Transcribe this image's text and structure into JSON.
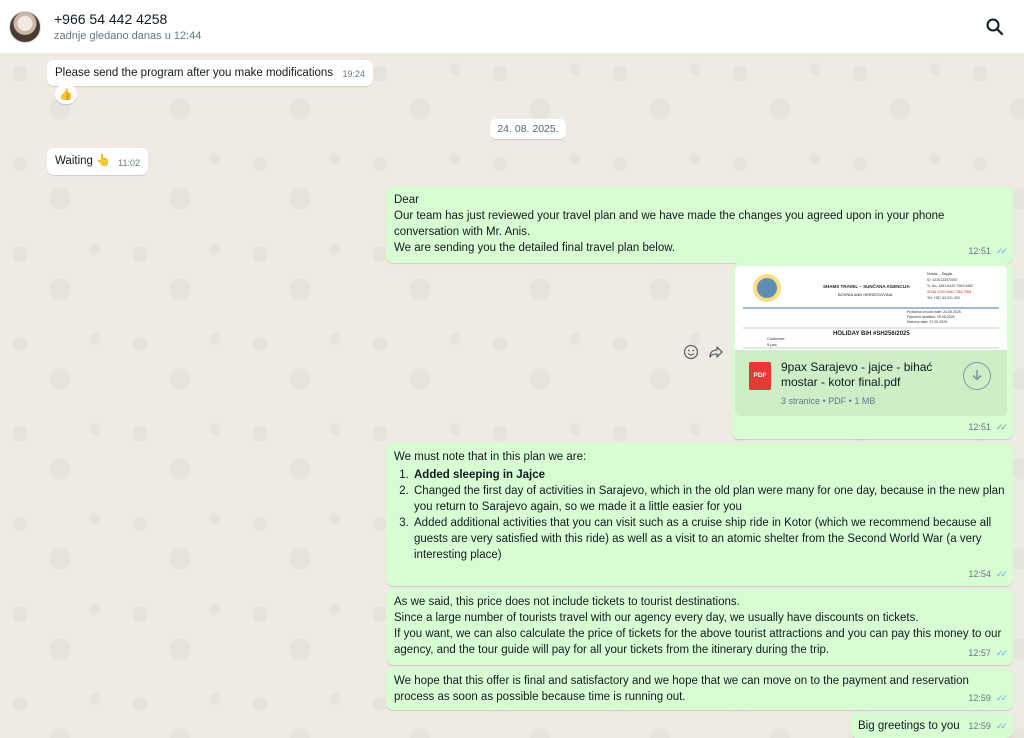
{
  "header": {
    "contact_name": "+966 54 442 4258",
    "last_seen": "zadnje gledano danas u 12:44"
  },
  "messages": {
    "m1": {
      "text": "Please send the program after you make modifications",
      "time": "19:24",
      "reaction": "👍"
    },
    "date_chip": "24. 08. 2025.",
    "m2": {
      "text": "Waiting 👆",
      "time": "11:02"
    },
    "m3": {
      "line1": "Dear",
      "line2": "Our team has just reviewed your travel plan and we have made the changes you agreed upon in your phone conversation with Mr. Anis.",
      "line3": "We are sending you the detailed final travel plan below.",
      "time": "12:51"
    },
    "m4": {
      "doc_preview": {
        "company": "SHAMS TRAVEL – SUNČANA AGENCIJA",
        "country": "BOSNIA AND HERZEGOVINA",
        "title": "HOLIDAY BiH #SH256/2025",
        "customer_label": "Customer:",
        "customer_value": "9 pax",
        "right_lines": [
          "Mostar – Šapjak",
          "ID: 4220133070007",
          "Tr. No. 1061-0022-7063-9482",
          "SH3A 2204 0940-7363-7964",
          "Tel: +387 63 021 000"
        ],
        "dates": [
          "Proforma Invoice date: 24.08.2025.",
          "Payment deadline: 25.08.2025.",
          "Delivery date: 07.09.2025."
        ]
      },
      "file_name": "9pax Sarajevo - jajce - bihać mostar - kotor final.pdf",
      "file_info": "3 stranice • PDF • 1 MB",
      "file_type": "PDF",
      "time": "12:51"
    },
    "m5": {
      "intro": "We must note that in this plan we are:",
      "items": [
        "Added sleeping in Jajce",
        "Changed the first day of activities in Sarajevo, which in the old plan were many for one day, because in the new plan you return to Sarajevo again, so we made it a little easier for you",
        "Added additional activities that you can visit such as a cruise ship ride in Kotor (which we recommend because all guests are very satisfied with this ride) as well as a visit to an atomic shelter from the Second World War (a very interesting place)"
      ],
      "time": "12:54"
    },
    "m6": {
      "line1": "As we said, this price does not include tickets to tourist destinations.",
      "line2": "Since a large number of tourists travel with our agency every day, we usually have discounts on tickets.",
      "line3": "If you want, we can also calculate the price of tickets for the above tourist attractions and you can pay this money to our agency, and the tour guide will pay for all your tickets from the itinerary during the trip.",
      "time": "12:57"
    },
    "m7": {
      "text": "We hope that this offer is final and satisfactory and we hope that we can move on to the payment and reservation process as soon as possible because time is running out.",
      "time": "12:59"
    },
    "m8": {
      "text": "Big greetings to you",
      "time": "12:59"
    }
  },
  "icons": {
    "search": "search-icon",
    "emoji": "emoji-icon",
    "forward": "forward-icon",
    "download": "download-icon",
    "read_ticks": "double-check-icon"
  },
  "colors": {
    "outgoing_bubble": "#d9fdd3",
    "incoming_bubble": "#ffffff",
    "chat_bg": "#efeae2",
    "read_tick": "#53bdeb"
  }
}
